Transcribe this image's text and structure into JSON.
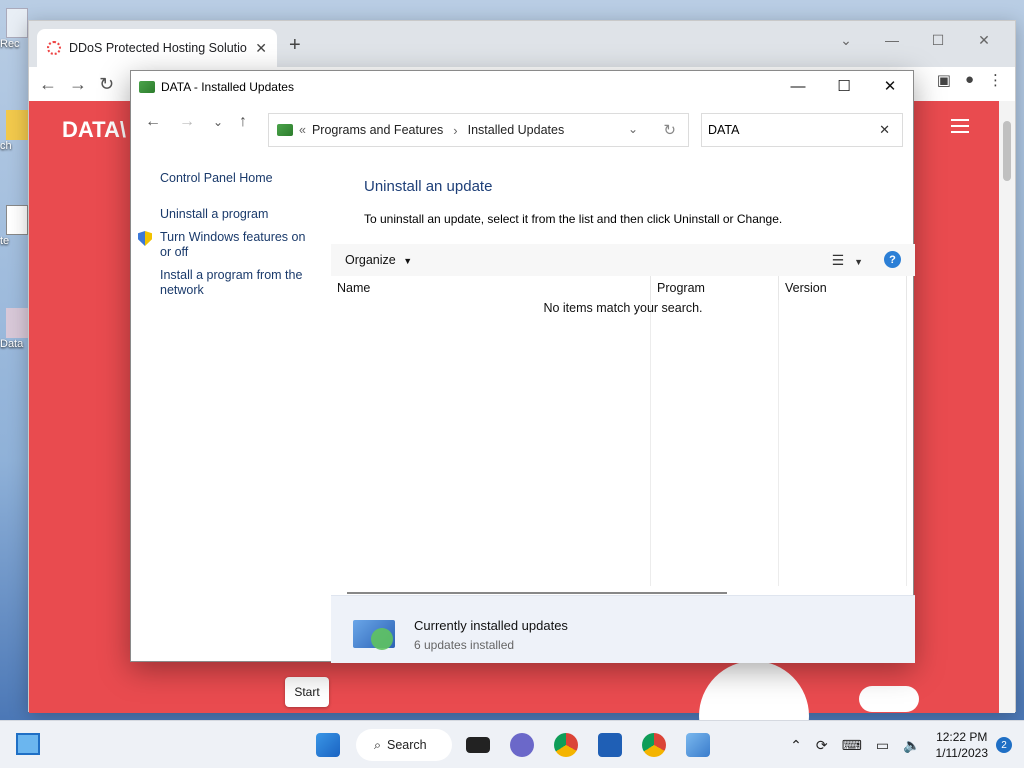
{
  "desktop": {
    "icons": [
      "Rec",
      "ch",
      "te",
      "Data"
    ]
  },
  "browser": {
    "tab_title": "DDoS Protected Hosting Solutio",
    "tab_close": "✕",
    "new_tab": "+",
    "page_logo": "DATA\\",
    "start_button": "Start"
  },
  "window": {
    "title": "DATA - Installed Updates",
    "minimize": "—",
    "maximize": "☐",
    "close": "✕"
  },
  "nav": {
    "back": "←",
    "forward": "→",
    "recent": "⌄",
    "up": "↑",
    "breadcrumb_prefix": "«",
    "breadcrumb": [
      "Programs and Features",
      "Installed Updates"
    ],
    "breadcrumb_sep": "›",
    "refresh": "↻",
    "search_value": "DATA",
    "search_clear": "✕"
  },
  "sidebar": {
    "items": [
      {
        "label": "Control Panel Home"
      },
      {
        "label": "Uninstall a program"
      },
      {
        "label": "Turn Windows features on or off"
      },
      {
        "label": "Install a program from the network"
      }
    ]
  },
  "main": {
    "heading": "Uninstall an update",
    "description": "To uninstall an update, select it from the list and then click Uninstall or Change.",
    "organize_label": "Organize",
    "help_label": "?",
    "columns": [
      "Name",
      "Program",
      "Version"
    ],
    "empty_message": "No items match your search."
  },
  "details": {
    "title": "Currently installed updates",
    "subtitle": "6 updates installed"
  },
  "taskbar": {
    "search_label": "Search",
    "time": "12:22 PM",
    "date": "1/11/2023",
    "notification_count": "2"
  }
}
